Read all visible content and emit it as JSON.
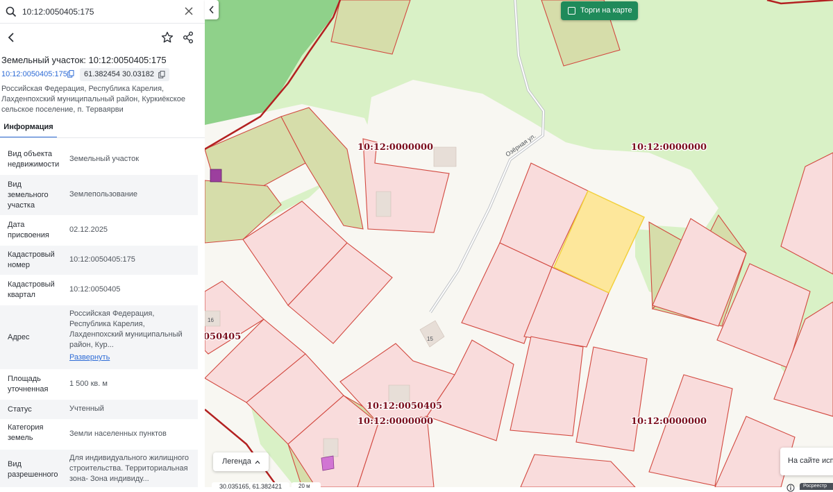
{
  "search": {
    "value": "10:12:0050405:175"
  },
  "title": "Земельный участок: 10:12:0050405:175",
  "chips": {
    "cadastral": "10:12:0050405:175",
    "coords": "61.382454 30.03182"
  },
  "address_lines": [
    "Российская Федерация, Республика Карелия,",
    "Лахденпохский муниципальный район, Куркиёкское",
    "сельское поселение, п. Терваярви"
  ],
  "tabs": {
    "info": "Информация"
  },
  "properties": [
    {
      "label": [
        "Вид объекта",
        "недвижимости"
      ],
      "value": [
        "Земельный участок"
      ]
    },
    {
      "label": [
        "Вид",
        "земельного",
        "участка"
      ],
      "value": [
        "Землепользование"
      ]
    },
    {
      "label": [
        "Дата",
        "присвоения"
      ],
      "value": [
        "02.12.2025"
      ]
    },
    {
      "label": [
        "Кадастровый",
        "номер"
      ],
      "value": [
        "10:12:0050405:175"
      ]
    },
    {
      "label": [
        "Кадастровый",
        "квартал"
      ],
      "value": [
        "10:12:0050405"
      ]
    },
    {
      "label": [
        "Адрес"
      ],
      "value": [
        "Российская Федерация,",
        "Республика Карелия,",
        "Лахденпохский муниципальный",
        "район, Кур..."
      ],
      "link": "Развернуть"
    },
    {
      "label": [
        "Площадь",
        "уточненная"
      ],
      "value": [
        "1 500 кв. м"
      ]
    },
    {
      "label": [
        "Статус"
      ],
      "value": [
        "Учтенный"
      ]
    },
    {
      "label": [
        "Категория",
        "земель"
      ],
      "value": [
        "Земли населенных пунктов"
      ]
    },
    {
      "label": [
        "Вид",
        "разрешенного"
      ],
      "value": [
        "Для индивидуального жилищного",
        "строительства. Территориальная",
        "зона- Зона индивиду..."
      ]
    }
  ],
  "map": {
    "auction_button": "Торги на карте",
    "legend_button": "Легенда",
    "notice": "На сайте исп",
    "coords_readout": "30.035165, 61.382421",
    "scale": "20 м",
    "corner_badge": "Росреестр",
    "street_label": "Озёрная ул.",
    "house_numbers": [
      "16",
      "15"
    ],
    "cadastral_labels": [
      "10:12:0000000",
      "10:12:0000000",
      "050405",
      "10:12:0050405",
      "10:12:0000000",
      "10:12:0000000"
    ],
    "colors": {
      "parcel_fill": "#f9dcdc",
      "parcel_stroke": "#d2483f",
      "selected_fill": "#fde79b",
      "selected_stroke": "#f2d03c",
      "green": "#d7f0c2",
      "road": "#f8f7f2",
      "forest": "#8fd18a",
      "auction": "#1f8a5a"
    }
  }
}
